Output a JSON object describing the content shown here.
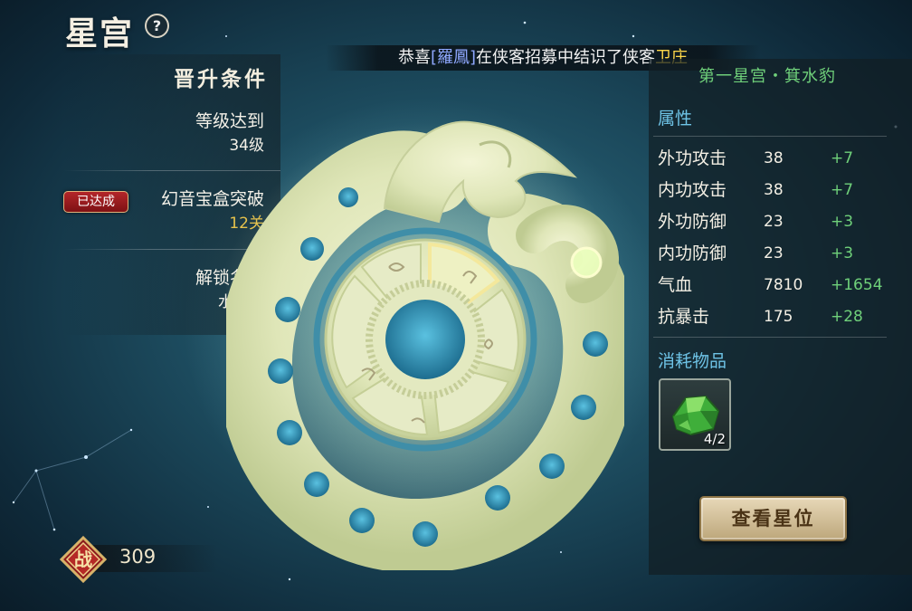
{
  "header": {
    "title": "星宫",
    "help_label": "?"
  },
  "announcement": {
    "prefix": "恭喜",
    "player": "[羅鳳]",
    "middle": "在侠客招募中结识了侠客",
    "hero": "卫庄"
  },
  "conditions": {
    "title": "晋升条件",
    "items": [
      {
        "label": "等级达到",
        "value": "34级",
        "status": ""
      },
      {
        "label": "幻音宝盒突破",
        "value": "12关",
        "status": "已达成"
      },
      {
        "label": "解锁名剑",
        "value": "水寒剑",
        "status": ""
      }
    ]
  },
  "palace": {
    "name": "第一星宫・箕水豹"
  },
  "attributes": {
    "title": "属性",
    "rows": [
      {
        "name": "外功攻击",
        "value": "38",
        "bonus": "+7"
      },
      {
        "name": "内功攻击",
        "value": "38",
        "bonus": "+7"
      },
      {
        "name": "外功防御",
        "value": "23",
        "bonus": "+3"
      },
      {
        "name": "内功防御",
        "value": "23",
        "bonus": "+3"
      },
      {
        "name": "气血",
        "value": "7810",
        "bonus": "+1654"
      },
      {
        "name": "抗暴击",
        "value": "175",
        "bonus": "+28"
      }
    ]
  },
  "consumables": {
    "title": "消耗物品",
    "item_icon": "green-jade-stone-icon",
    "count": "4/2"
  },
  "actions": {
    "view_stars_label": "查看星位"
  },
  "power": {
    "icon_glyph": "战",
    "value": "309"
  },
  "colors": {
    "accent_blue": "#6ec3e6",
    "bonus_green": "#6fd07a",
    "gold": "#e6c24c",
    "badge_red": "#b3262a"
  }
}
